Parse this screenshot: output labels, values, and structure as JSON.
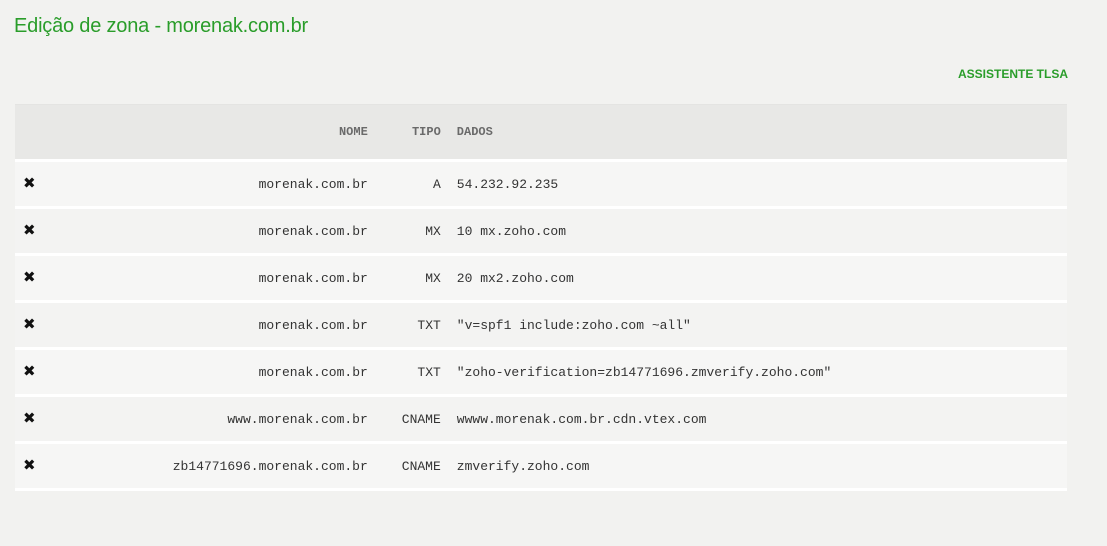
{
  "page": {
    "title": "Edição de zona - morenak.com.br",
    "tlsa_link": "ASSISTENTE TLSA"
  },
  "table": {
    "headers": {
      "name": "NOME",
      "type": "TIPO",
      "data": "DADOS"
    },
    "delete_icon": "✖",
    "rows": [
      {
        "name": "morenak.com.br",
        "type": "A",
        "data": "54.232.92.235"
      },
      {
        "name": "morenak.com.br",
        "type": "MX",
        "data": "10 mx.zoho.com"
      },
      {
        "name": "morenak.com.br",
        "type": "MX",
        "data": "20 mx2.zoho.com"
      },
      {
        "name": "morenak.com.br",
        "type": "TXT",
        "data": "\"v=spf1 include:zoho.com ~all\""
      },
      {
        "name": "morenak.com.br",
        "type": "TXT",
        "data": "\"zoho-verification=zb14771696.zmverify.zoho.com\""
      },
      {
        "name": "www.morenak.com.br",
        "type": "CNAME",
        "data": "wwww.morenak.com.br.cdn.vtex.com"
      },
      {
        "name": "zb14771696.morenak.com.br",
        "type": "CNAME",
        "data": "zmverify.zoho.com"
      }
    ]
  },
  "colors": {
    "accent": "#2a9d2a",
    "background": "#f2f2f0"
  }
}
